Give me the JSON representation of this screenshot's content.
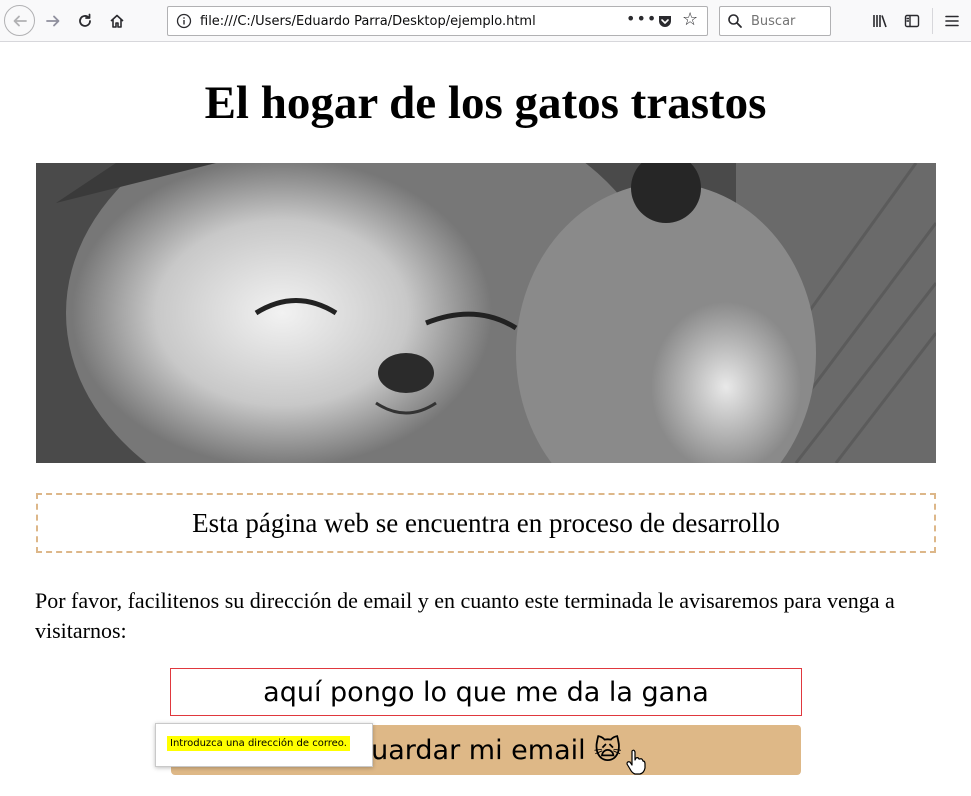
{
  "browser": {
    "url": "file:///C:/Users/Eduardo Parra/Desktop/ejemplo.html",
    "search_placeholder": "Buscar",
    "overflow_dots": "•••"
  },
  "page": {
    "title": "El hogar de los gatos trastos",
    "notice": "Esta página web se encuentra en proceso de desarrollo",
    "intro": "Por favor, facilitenos su dirección de email y en cuanto este terminada le avisaremos para venga a visitarnos:",
    "email_value": "aquí pongo lo que me da la gana",
    "save_label": "Guardar mi email",
    "save_emoji": "🙀",
    "tooltip": "Introduzca una dirección de correo."
  },
  "colors": {
    "notice_border": "#ddb789",
    "button_bg": "#deb887",
    "input_border_invalid": "#e0383e",
    "tooltip_highlight": "#ffff00"
  }
}
